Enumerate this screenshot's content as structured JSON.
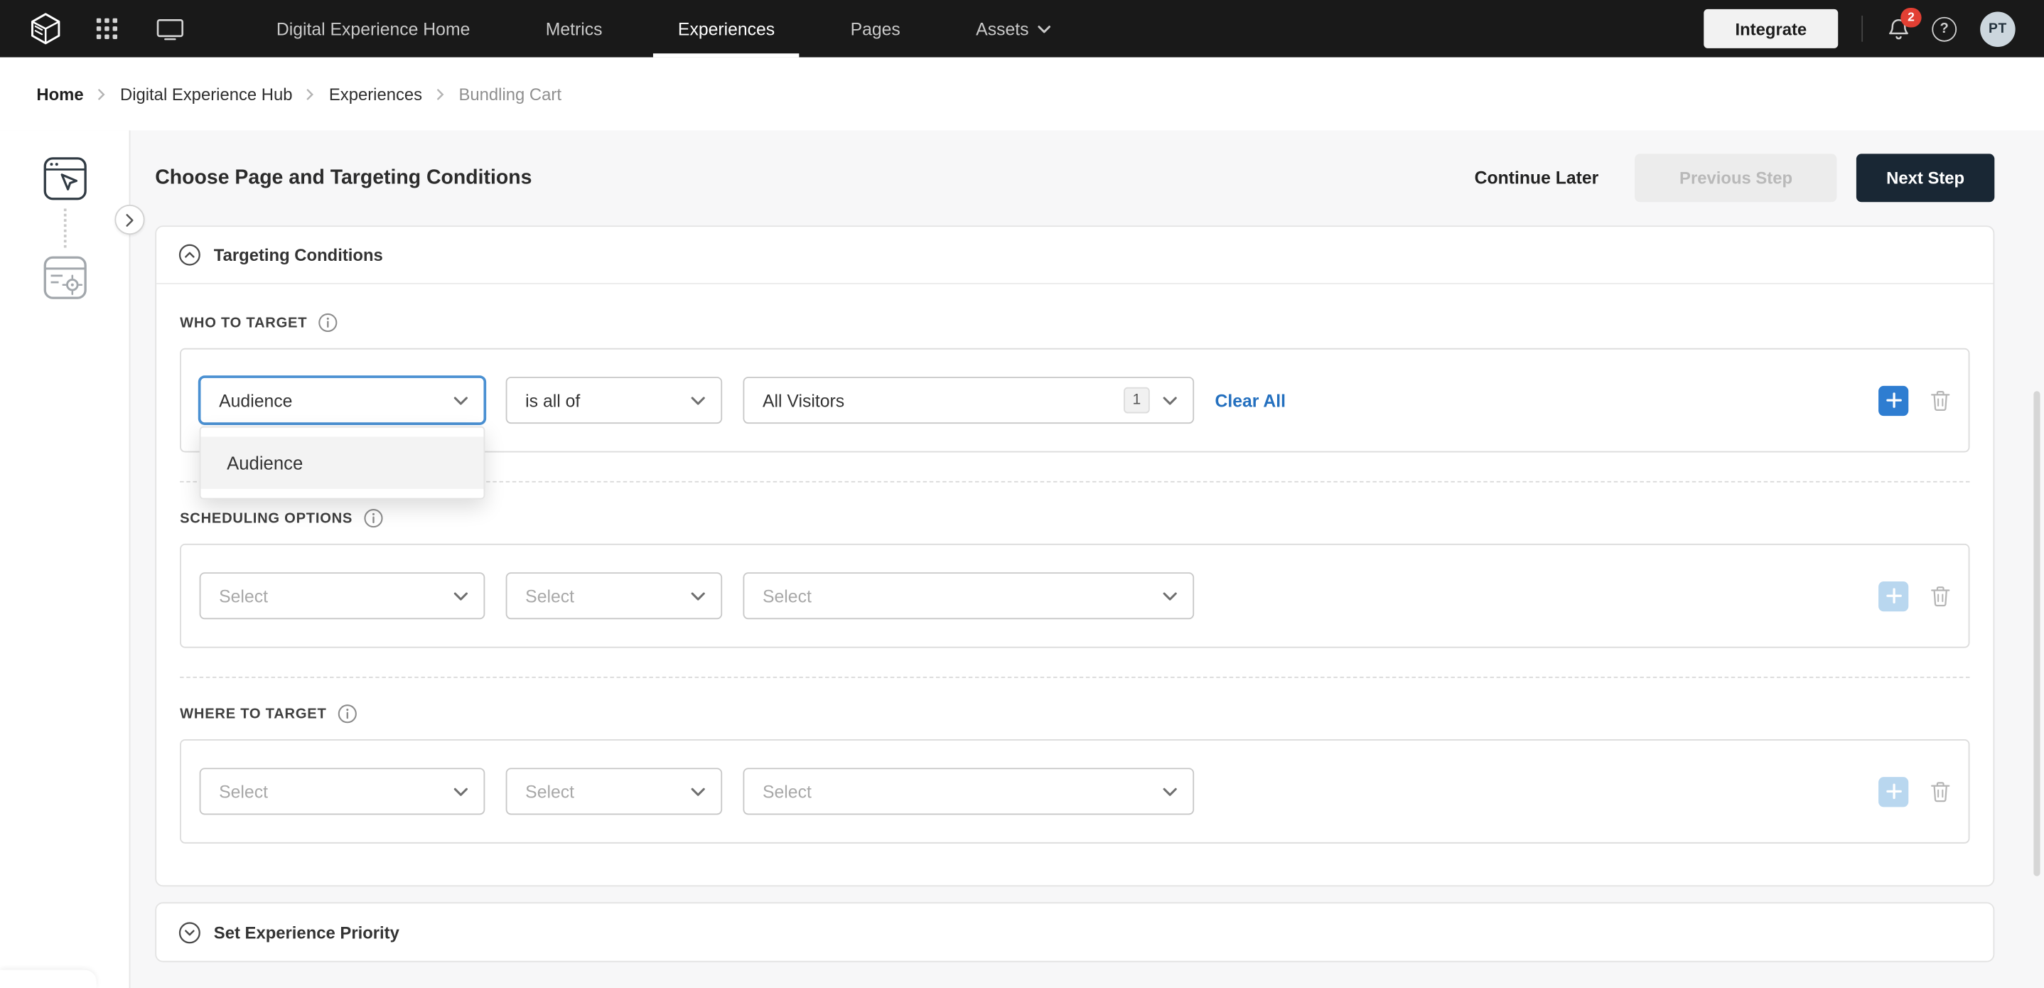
{
  "nav": {
    "items": [
      "Digital Experience Home",
      "Metrics",
      "Experiences",
      "Pages",
      "Assets"
    ],
    "active_item": "Experiences",
    "integrate_label": "Integrate",
    "notification_count": "2",
    "help_glyph": "?",
    "avatar_initials": "PT"
  },
  "breadcrumb": {
    "items": [
      "Home",
      "Digital Experience Hub",
      "Experiences",
      "Bundling Cart"
    ]
  },
  "header": {
    "title": "Choose Page and Targeting Conditions",
    "continue_later_label": "Continue Later",
    "previous_step_label": "Previous Step",
    "next_step_label": "Next Step"
  },
  "targeting_card": {
    "title": "Targeting Conditions",
    "who_to_target": {
      "label": "WHO TO TARGET",
      "type_value": "Audience",
      "operator_value": "is all of",
      "value_value": "All Visitors",
      "count_badge": "1",
      "clear_all_label": "Clear All",
      "dropdown_options": [
        "Audience"
      ]
    },
    "scheduling": {
      "label": "SCHEDULING OPTIONS",
      "select_placeholder": "Select"
    },
    "where_to_target": {
      "label": "WHERE TO TARGET",
      "select_placeholder": "Select"
    }
  },
  "priority_card": {
    "title": "Set Experience Priority"
  },
  "colors": {
    "nav_bg": "#191919",
    "accent_blue": "#2e7dd1",
    "focus_blue": "#4a90d2",
    "link_blue": "#2470bf",
    "danger_badge": "#e23f33",
    "dark_button": "#192734",
    "disabled_button_bg": "#ececec"
  }
}
